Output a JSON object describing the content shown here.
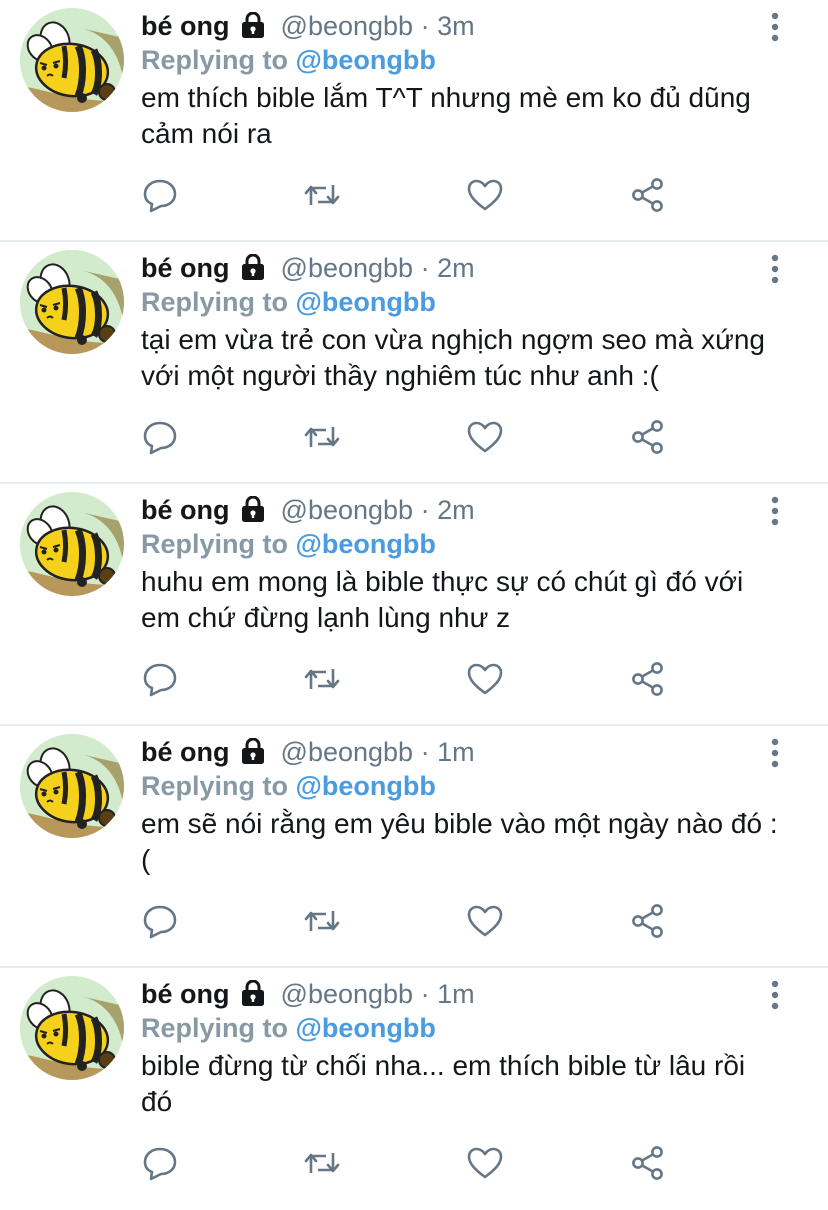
{
  "tweets": [
    {
      "display_name": "bé ong",
      "handle": "@beongbb",
      "separator": "·",
      "time": "3m",
      "replying_prefix": "Replying to",
      "replying_to": "@beongbb",
      "text": "em thích bible lắm T^T nhưng mè em ko đủ dũng cảm nói ra"
    },
    {
      "display_name": "bé ong",
      "handle": "@beongbb",
      "separator": "·",
      "time": "2m",
      "replying_prefix": "Replying to",
      "replying_to": "@beongbb",
      "text": "tại em vừa trẻ con vừa nghịch ngợm seo mà xứng với một người thầy nghiêm túc như anh :("
    },
    {
      "display_name": "bé ong",
      "handle": "@beongbb",
      "separator": "·",
      "time": "2m",
      "replying_prefix": "Replying to",
      "replying_to": "@beongbb",
      "text": "huhu em mong là bible thực sự có chút gì đó với em chứ đừng lạnh lùng như z"
    },
    {
      "display_name": "bé ong",
      "handle": "@beongbb",
      "separator": "·",
      "time": "1m",
      "replying_prefix": "Replying to",
      "replying_to": "@beongbb",
      "text": "em sẽ nói rằng em yêu bible vào một ngày nào đó :("
    },
    {
      "display_name": "bé ong",
      "handle": "@beongbb",
      "separator": "·",
      "time": "1m",
      "replying_prefix": "Replying to",
      "replying_to": "@beongbb",
      "text": "bible đừng từ chối nha... em thích bible từ lâu rồi đó"
    }
  ],
  "icons": {
    "more": "more-vertical-icon",
    "reply": "reply-bubble-icon",
    "retweet": "retweet-icon",
    "like": "heart-icon",
    "share": "share-icon",
    "lock": "lock-icon"
  },
  "colors": {
    "mention": "#4a9be0",
    "muted": "#657786",
    "icon": "#657786",
    "divider": "#e6ecf0"
  }
}
